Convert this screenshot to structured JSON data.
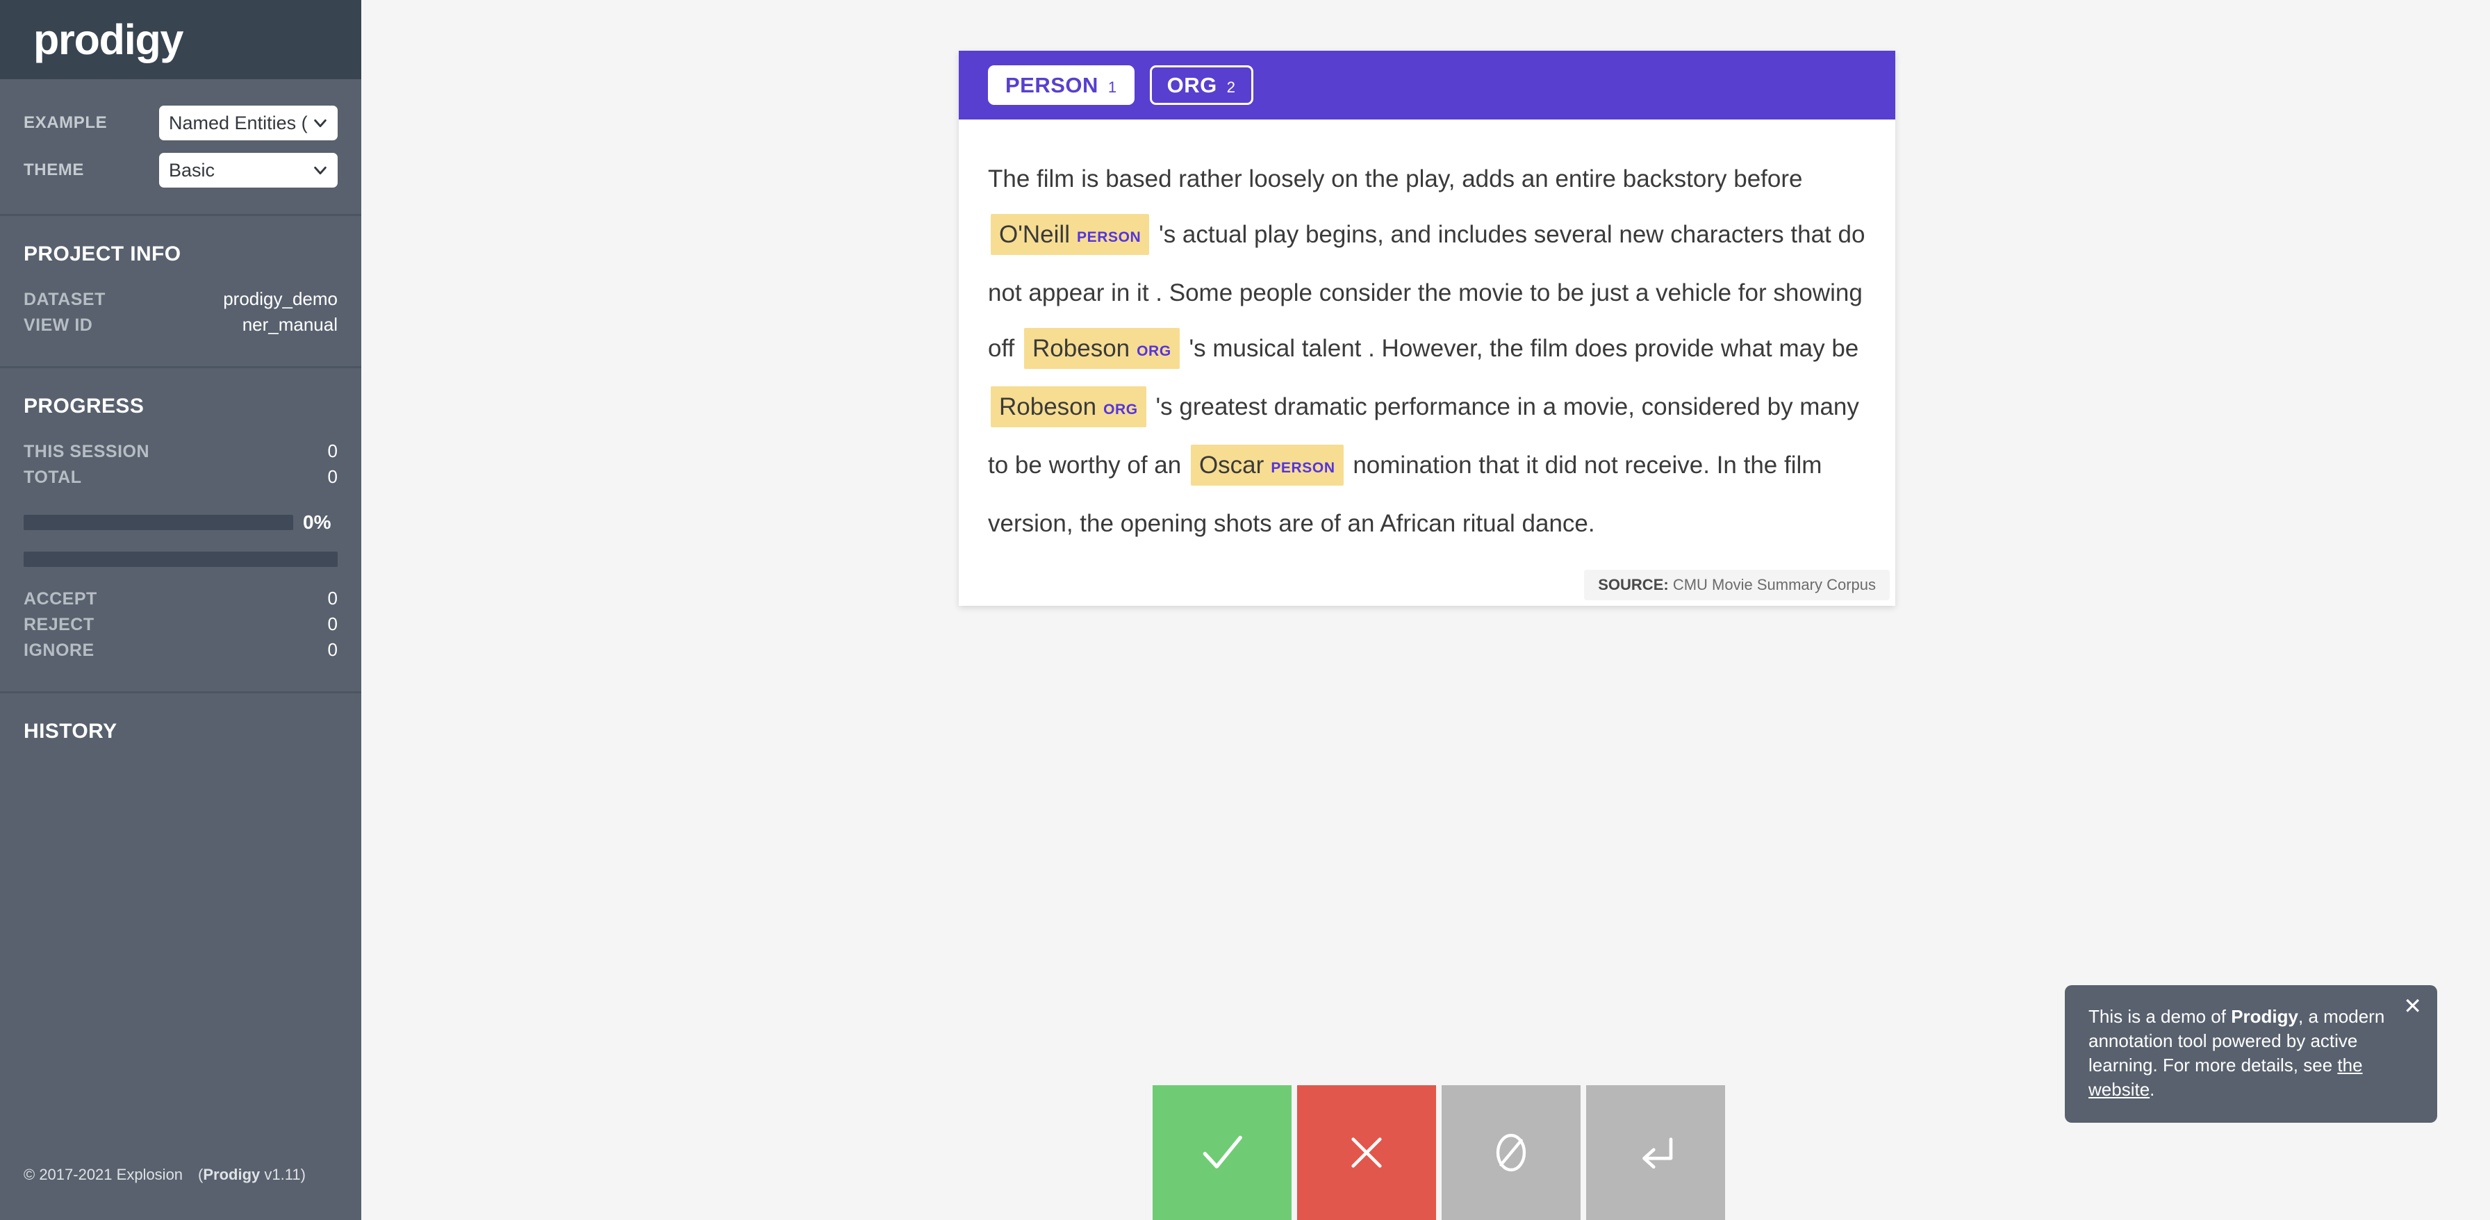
{
  "sidebar": {
    "logo": "prodigy",
    "controls": [
      {
        "label": "EXAMPLE",
        "value": "Named Entities (r",
        "name": "example-select"
      },
      {
        "label": "THEME",
        "value": "Basic",
        "name": "theme-select"
      }
    ],
    "project_info": {
      "heading": "PROJECT INFO",
      "rows": [
        {
          "key": "DATASET",
          "value": "prodigy_demo"
        },
        {
          "key": "VIEW ID",
          "value": "ner_manual"
        }
      ]
    },
    "progress": {
      "heading": "PROGRESS",
      "rows": [
        {
          "key": "THIS SESSION",
          "value": "0"
        },
        {
          "key": "TOTAL",
          "value": "0"
        }
      ],
      "percent_label": "0%",
      "percent_value": 0,
      "counts": [
        {
          "key": "ACCEPT",
          "value": "0"
        },
        {
          "key": "REJECT",
          "value": "0"
        },
        {
          "key": "IGNORE",
          "value": "0"
        }
      ]
    },
    "history": {
      "heading": "HISTORY"
    },
    "footer": {
      "copyright": "© 2017-2021 Explosion",
      "product": "Prodigy",
      "version": "v1.11"
    }
  },
  "card": {
    "labels": [
      {
        "text": "PERSON",
        "shortcut": "1",
        "active": true
      },
      {
        "text": "ORG",
        "shortcut": "2",
        "active": false
      }
    ],
    "tokens": [
      {
        "type": "text",
        "text": "The film is based rather loosely on the play, adds an entire backstory before "
      },
      {
        "type": "entity",
        "text": "O'Neill",
        "label": "PERSON"
      },
      {
        "type": "text",
        "text": " 's actual play begins, and includes several new characters that do not appear in it . Some people consider the movie to be just a vehicle for showing off "
      },
      {
        "type": "entity",
        "text": "Robeson",
        "label": "ORG"
      },
      {
        "type": "text",
        "text": " 's musical talent . However, the film does provide what may be "
      },
      {
        "type": "entity",
        "text": "Robeson",
        "label": "ORG"
      },
      {
        "type": "text",
        "text": " 's greatest dramatic performance in a movie, considered by many to be worthy of an "
      },
      {
        "type": "entity",
        "text": "Oscar",
        "label": "PERSON"
      },
      {
        "type": "text",
        "text": " nomination that it did not receive. In the film version, the opening shots are of an African ritual dance."
      }
    ],
    "source_key": "SOURCE:",
    "source_value": "CMU Movie Summary Corpus"
  },
  "actions": [
    {
      "name": "accept",
      "icon": "check-icon",
      "color": "#6fcc74"
    },
    {
      "name": "reject",
      "icon": "cross-icon",
      "color": "#e2574c"
    },
    {
      "name": "ignore",
      "icon": "circle-slash-icon",
      "color": "#b7b7b7"
    },
    {
      "name": "undo",
      "icon": "return-arrow-icon",
      "color": "#b7b7b7"
    }
  ],
  "toast": {
    "part1": "This is a demo of ",
    "brand": "Prodigy",
    "part2": ", a modern annotation tool powered by active learning. For more details, see ",
    "link": "the website",
    "part3": ".",
    "close": "✕"
  },
  "colors": {
    "sidebar_bg": "#58616d",
    "sidebar_logo_bg": "#394451",
    "accent_purple": "#583fcf",
    "entity_highlight": "#f7dd91",
    "entity_label": "#5434e0",
    "accept_green": "#6fcc74",
    "reject_red": "#e2574c",
    "neutral_gray": "#b7b7b7",
    "page_bg": "#f5f5f5"
  }
}
